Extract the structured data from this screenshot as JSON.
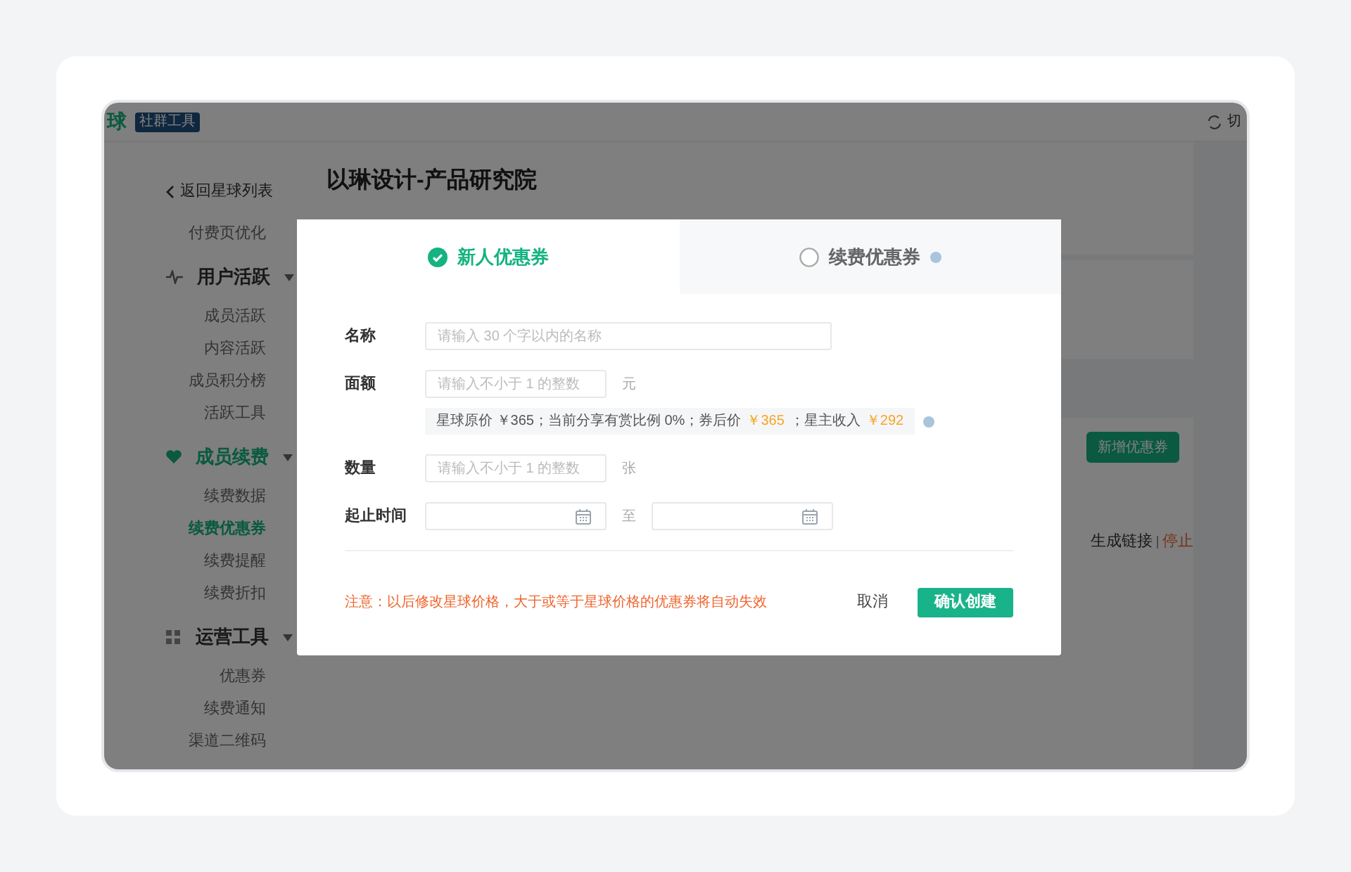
{
  "topbar": {
    "logo": "球",
    "badge": "社群工具",
    "switch_label": "切"
  },
  "sidebar": {
    "items": [
      {
        "kind": "back",
        "label": "返回星球列表",
        "selected": false
      },
      {
        "kind": "item",
        "label": "付费页优化",
        "selected": false
      },
      {
        "kind": "group",
        "label": "用户活跃",
        "selected": false
      },
      {
        "kind": "item",
        "label": "成员活跃",
        "selected": false
      },
      {
        "kind": "item",
        "label": "内容活跃",
        "selected": false
      },
      {
        "kind": "item",
        "label": "成员积分榜",
        "selected": false
      },
      {
        "kind": "item",
        "label": "活跃工具",
        "selected": false
      },
      {
        "kind": "group",
        "label": "成员续费",
        "selected": true
      },
      {
        "kind": "item",
        "label": "续费数据",
        "selected": false
      },
      {
        "kind": "item",
        "label": "续费优惠券",
        "selected": true
      },
      {
        "kind": "item",
        "label": "续费提醒",
        "selected": false
      },
      {
        "kind": "item",
        "label": "续费折扣",
        "selected": false
      },
      {
        "kind": "group",
        "label": "运营工具",
        "selected": false
      },
      {
        "kind": "item",
        "label": "优惠券",
        "selected": false
      },
      {
        "kind": "item",
        "label": "续费通知",
        "selected": false
      },
      {
        "kind": "item",
        "label": "渠道二维码",
        "selected": false
      }
    ]
  },
  "main": {
    "title": "以琳设计-产品研究院",
    "add_button": "新增优惠券",
    "row_actions": [
      {
        "label": "生成链接",
        "kind": "normal"
      },
      {
        "label": "停止",
        "kind": "danger"
      }
    ]
  },
  "dialog": {
    "tabs": [
      {
        "label": "新人优惠券",
        "selected": true,
        "info_icon": false
      },
      {
        "label": "续费优惠券",
        "selected": false,
        "info_icon": true
      }
    ],
    "fields": [
      {
        "kind": "text",
        "label": "名称",
        "placeholder": "请输入 30 个字以内的名称"
      },
      {
        "kind": "number",
        "label": "面额",
        "placeholder": "请输入不小于 1 的整数",
        "unit": "元",
        "hint": [
          {
            "kind": "plain",
            "text": "星球原价 ￥365；当前分享有赏比例 0%；券后价"
          },
          {
            "kind": "price",
            "text": "￥365"
          },
          {
            "kind": "plain",
            "text": "；星主收入"
          },
          {
            "kind": "price",
            "text": "￥292"
          }
        ]
      },
      {
        "kind": "number",
        "label": "数量",
        "placeholder": "请输入不小于 1 的整数",
        "unit": "张"
      },
      {
        "kind": "daterange",
        "label": "起止时间",
        "separator": "至"
      }
    ],
    "note": "注意：以后修改星球价格，大于或等于星球价格的优惠券将自动失效",
    "cancel": "取消",
    "confirm": "确认创建"
  }
}
